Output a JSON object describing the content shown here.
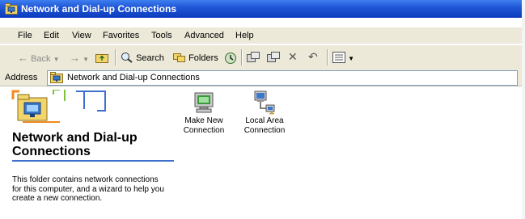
{
  "window": {
    "title": "Network and Dial-up Connections"
  },
  "menu": [
    "File",
    "Edit",
    "View",
    "Favorites",
    "Tools",
    "Advanced",
    "Help"
  ],
  "toolbar": {
    "back_label": "Back",
    "search_label": "Search",
    "folders_label": "Folders"
  },
  "address": {
    "label": "Address",
    "value": "Network and Dial-up Connections"
  },
  "left_pane": {
    "title_line1": "Network and Dial-up",
    "title_line2": "Connections",
    "description": "This folder contains network connections for this computer, and a wizard to help you create a new connection."
  },
  "items": [
    {
      "label_line1": "Make New",
      "label_line2": "Connection"
    },
    {
      "label_line1": "Local Area",
      "label_line2": "Connection"
    }
  ],
  "colors": {
    "titlebar": "#0b3cbd",
    "banner_blue": "#3d6fcf",
    "banner_orange": "#f08a1c",
    "banner_green": "#7cc23a",
    "toolbar_bg": "#ece9d8"
  }
}
